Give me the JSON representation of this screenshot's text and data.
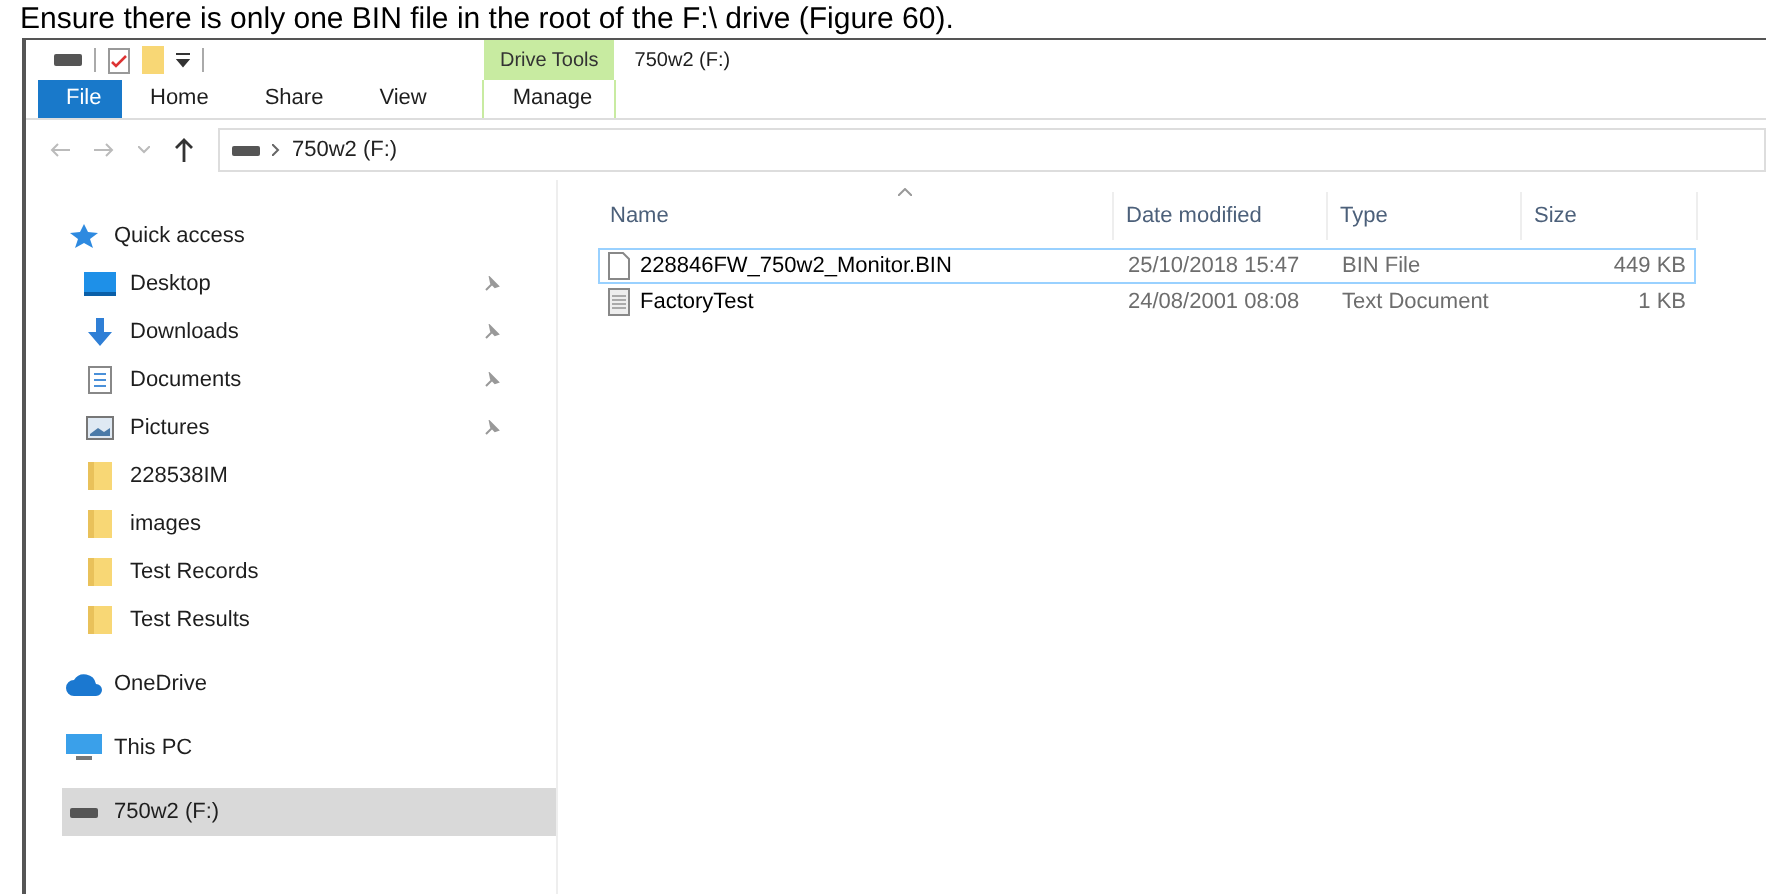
{
  "document_text": "Ensure there is only one BIN file in the root of the F:\\ drive (Figure 60).",
  "window": {
    "title": "750w2 (F:)",
    "contextual_tab": "Drive Tools"
  },
  "ribbon_tabs": [
    {
      "label": "File",
      "kind": "file",
      "selected": false
    },
    {
      "label": "Home",
      "kind": "tab",
      "selected": false
    },
    {
      "label": "Share",
      "kind": "tab",
      "selected": false
    },
    {
      "label": "View",
      "kind": "tab",
      "selected": false
    },
    {
      "label": "Manage",
      "kind": "contextual",
      "selected": false
    }
  ],
  "address": {
    "path": "750w2 (F:)"
  },
  "nav": [
    {
      "label": "Quick access",
      "kind": "star",
      "selected": false,
      "children": [
        {
          "label": "Desktop",
          "kind": "desktop",
          "pinned": true,
          "selected": false
        },
        {
          "label": "Downloads",
          "kind": "download",
          "pinned": true,
          "selected": false
        },
        {
          "label": "Documents",
          "kind": "document",
          "pinned": true,
          "selected": false
        },
        {
          "label": "Pictures",
          "kind": "picture",
          "pinned": true,
          "selected": false
        },
        {
          "label": "228538IM",
          "kind": "folder",
          "selected": false
        },
        {
          "label": "images",
          "kind": "folder",
          "selected": false
        },
        {
          "label": "Test Records",
          "kind": "folder",
          "selected": false
        },
        {
          "label": "Test Results",
          "kind": "folder",
          "selected": false
        }
      ]
    },
    {
      "label": "OneDrive",
      "kind": "cloud",
      "selected": false
    },
    {
      "label": "This PC",
      "kind": "pc",
      "selected": false
    },
    {
      "label": "750w2 (F:)",
      "kind": "drive",
      "selected": true
    }
  ],
  "files": {
    "columns": [
      "Name",
      "Date modified",
      "Type",
      "Size"
    ],
    "rows": [
      {
        "name": "228846FW_750w2_Monitor.BIN",
        "date": "25/10/2018 15:47",
        "type": "BIN File",
        "size": "449 KB",
        "kind": "file",
        "selected": true
      },
      {
        "name": "FactoryTest",
        "date": "24/08/2001 08:08",
        "type": "Text Document",
        "size": "1 KB",
        "kind": "text",
        "selected": false
      }
    ]
  }
}
